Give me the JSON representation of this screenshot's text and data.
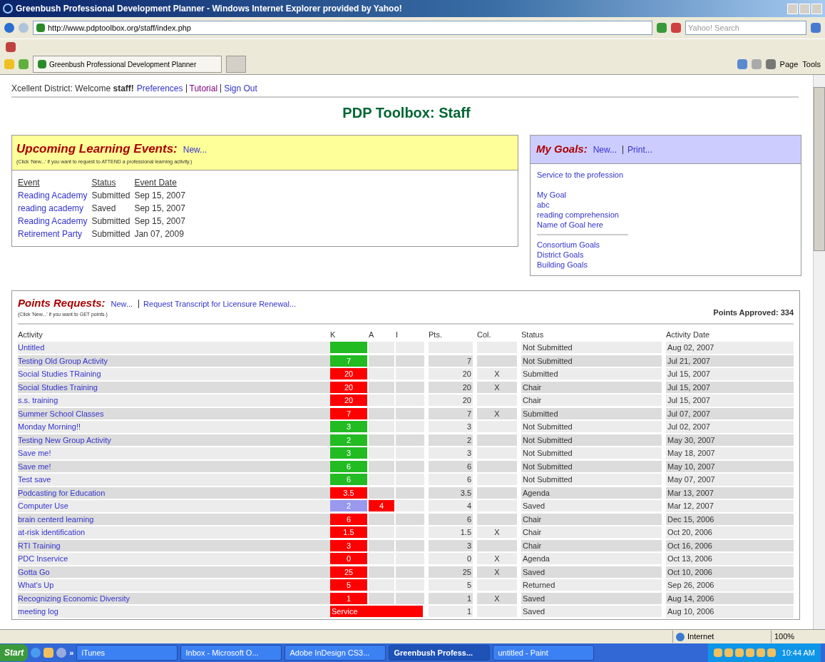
{
  "window": {
    "title": "Greenbush Professional Development Planner - Windows Internet Explorer provided by Yahoo!"
  },
  "address_bar": {
    "url": "http://www.pdptoolbox.org/staff/index.php",
    "search_placeholder": "Yahoo! Search"
  },
  "browser_tab": {
    "label": "Greenbush Professional Development Planner",
    "selected": true
  },
  "command_bar": [
    "Page",
    "Tools"
  ],
  "user_bar": {
    "district": "Xcellent District: Welcome",
    "user": "staff!",
    "links": [
      {
        "label": "Preferences",
        "visited": false
      },
      {
        "label": "Tutorial",
        "visited": true
      },
      {
        "label": "Sign Out",
        "visited": false
      }
    ]
  },
  "page_title": "PDP Toolbox: Staff",
  "events_panel": {
    "title": "Upcoming Learning Events:",
    "new_link": "New...",
    "hint": "(Click 'New...' if you want to request to ATTEND a professional learning activity.)",
    "columns": [
      "Event",
      "Status",
      "Event Date"
    ],
    "rows": [
      {
        "event": "Reading Academy",
        "status": "Submitted",
        "date": "Sep 15, 2007"
      },
      {
        "event": "reading academy",
        "status": "Saved",
        "date": "Sep 15, 2007"
      },
      {
        "event": "Reading Academy",
        "status": "Submitted",
        "date": "Sep 15, 2007"
      },
      {
        "event": "Retirement Party",
        "status": "Submitted",
        "date": "Jan 07, 2009"
      }
    ]
  },
  "goals_panel": {
    "title": "My Goals:",
    "links": [
      "New...",
      "Print..."
    ],
    "groups": [
      [
        "Service to the profession"
      ],
      [
        "My Goal",
        "abc",
        "reading comprehension",
        "Name of Goal here"
      ],
      [
        "Consortium Goals",
        "District Goals",
        "Building Goals"
      ]
    ]
  },
  "points_panel": {
    "title": "Points Requests:",
    "links": [
      "New...",
      "Request Transcript for Licensure Renewal..."
    ],
    "hint": "(Click 'New...' if you want to GET points.)",
    "approved": "Points Approved: 334",
    "columns": [
      "Activity",
      "K",
      "A",
      "I",
      "Pts.",
      "Col.",
      "Status",
      "Activity Date"
    ],
    "rows": [
      {
        "activity": "Untitled",
        "bars": [
          {
            "kind": "cell",
            "color": "#22bb22"
          }
        ],
        "pts": "",
        "col": "",
        "status": "Not Submitted",
        "date": "Aug 02, 2007"
      },
      {
        "activity": "Testing Old Group Activity",
        "bars": [
          {
            "kind": "cell",
            "color": "#22bb22",
            "text": "7"
          }
        ],
        "pts": "7",
        "col": "",
        "status": "Not Submitted",
        "date": "Jul 21, 2007"
      },
      {
        "activity": "Social Studies TRaining",
        "bars": [
          {
            "kind": "cell",
            "color": "#ff0000",
            "text": "20"
          }
        ],
        "pts": "20",
        "col": "X",
        "status": "Submitted",
        "date": "Jul 15, 2007"
      },
      {
        "activity": "Social Studies Training",
        "bars": [
          {
            "kind": "cell",
            "color": "#ff0000",
            "text": "20"
          }
        ],
        "pts": "20",
        "col": "X",
        "status": "Chair",
        "date": "Jul 15, 2007"
      },
      {
        "activity": "s.s. training",
        "bars": [
          {
            "kind": "cell",
            "color": "#ff0000",
            "text": "20"
          }
        ],
        "pts": "20",
        "col": "",
        "status": "Chair",
        "date": "Jul 15, 2007"
      },
      {
        "activity": "Summer School Classes",
        "bars": [
          {
            "kind": "cell",
            "color": "#ff0000",
            "text": "7"
          }
        ],
        "pts": "7",
        "col": "X",
        "status": "Submitted",
        "date": "Jul 07, 2007"
      },
      {
        "activity": "Monday Morning!!",
        "bars": [
          {
            "kind": "cell",
            "color": "#22bb22",
            "text": "3"
          }
        ],
        "pts": "3",
        "col": "",
        "status": "Not Submitted",
        "date": "Jul 02, 2007"
      },
      {
        "activity": "Testing New Group Activity",
        "bars": [
          {
            "kind": "cell",
            "color": "#22bb22",
            "text": "2"
          }
        ],
        "pts": "2",
        "col": "",
        "status": "Not Submitted",
        "date": "May 30, 2007"
      },
      {
        "activity": "Save me!",
        "bars": [
          {
            "kind": "cell",
            "color": "#22bb22",
            "text": "3"
          }
        ],
        "pts": "3",
        "col": "",
        "status": "Not Submitted",
        "date": "May 18, 2007"
      },
      {
        "activity": "Save me!",
        "bars": [
          {
            "kind": "cell",
            "color": "#22bb22",
            "text": "6"
          }
        ],
        "pts": "6",
        "col": "",
        "status": "Not Submitted",
        "date": "May 10, 2007"
      },
      {
        "activity": "Test save",
        "bars": [
          {
            "kind": "cell",
            "color": "#22bb22",
            "text": "6"
          }
        ],
        "pts": "6",
        "col": "",
        "status": "Not Submitted",
        "date": "May 07, 2007"
      },
      {
        "activity": "Podcasting for Education",
        "bars": [
          {
            "kind": "cell",
            "color": "#ff0000",
            "text": "3.5"
          }
        ],
        "pts": "3.5",
        "col": "",
        "status": "Agenda",
        "date": "Mar 13, 2007"
      },
      {
        "activity": "Computer Use",
        "bars": [
          {
            "kind": "cell",
            "color": "#9999ee",
            "text": "2"
          },
          {
            "kind": "cell",
            "color": "#ff0000",
            "text": "4"
          }
        ],
        "pts": "4",
        "col": "",
        "status": "Saved",
        "date": "Mar 12, 2007"
      },
      {
        "activity": "brain centerd learning",
        "bars": [
          {
            "kind": "cell",
            "color": "#ff0000",
            "text": "6"
          }
        ],
        "pts": "6",
        "col": "",
        "status": "Chair",
        "date": "Dec 15, 2006"
      },
      {
        "activity": "at-risk identification",
        "bars": [
          {
            "kind": "cell",
            "color": "#ff0000",
            "text": "1.5"
          }
        ],
        "pts": "1.5",
        "col": "X",
        "status": "Chair",
        "date": "Oct 20, 2006"
      },
      {
        "activity": "RTI Training",
        "bars": [
          {
            "kind": "cell",
            "color": "#ff0000",
            "text": "3"
          }
        ],
        "pts": "3",
        "col": "",
        "status": "Chair",
        "date": "Oct 16, 2006"
      },
      {
        "activity": "PDC Inservice",
        "bars": [
          {
            "kind": "cell",
            "color": "#ff0000",
            "text": "0"
          }
        ],
        "pts": "0",
        "col": "X",
        "status": "Agenda",
        "date": "Oct 13, 2006"
      },
      {
        "activity": "Gotta Go",
        "bars": [
          {
            "kind": "cell",
            "color": "#ff0000",
            "text": "25"
          }
        ],
        "pts": "25",
        "col": "X",
        "status": "Saved",
        "date": "Oct 10, 2006"
      },
      {
        "activity": "What's Up",
        "bars": [
          {
            "kind": "cell",
            "color": "#ff0000",
            "text": "5"
          }
        ],
        "pts": "5",
        "col": "",
        "status": "Returned",
        "date": "Sep 26, 2006"
      },
      {
        "activity": "Recognizing Economic Diversity",
        "bars": [
          {
            "kind": "cell",
            "color": "#ff0000",
            "text": "1"
          }
        ],
        "pts": "1",
        "col": "X",
        "status": "Saved",
        "date": "Aug 14, 2006"
      },
      {
        "activity": "meeting log",
        "bars": [
          {
            "kind": "span",
            "color": "#ff0000",
            "text": "Service"
          }
        ],
        "pts": "1",
        "col": "",
        "status": "Saved",
        "date": "Aug 10, 2006"
      }
    ]
  },
  "status_bar": {
    "zone": "Internet",
    "zoom": "100%"
  },
  "taskbar": {
    "start": "Start",
    "more": "»",
    "tasks": [
      {
        "label": "iTunes",
        "selected": false
      },
      {
        "label": "Inbox - Microsoft O...",
        "selected": false
      },
      {
        "label": "Adobe InDesign CS3...",
        "selected": false
      },
      {
        "label": "Greenbush Profess...",
        "selected": true
      },
      {
        "label": "untitled - Paint",
        "selected": false
      }
    ],
    "clock": "10:44 AM"
  }
}
